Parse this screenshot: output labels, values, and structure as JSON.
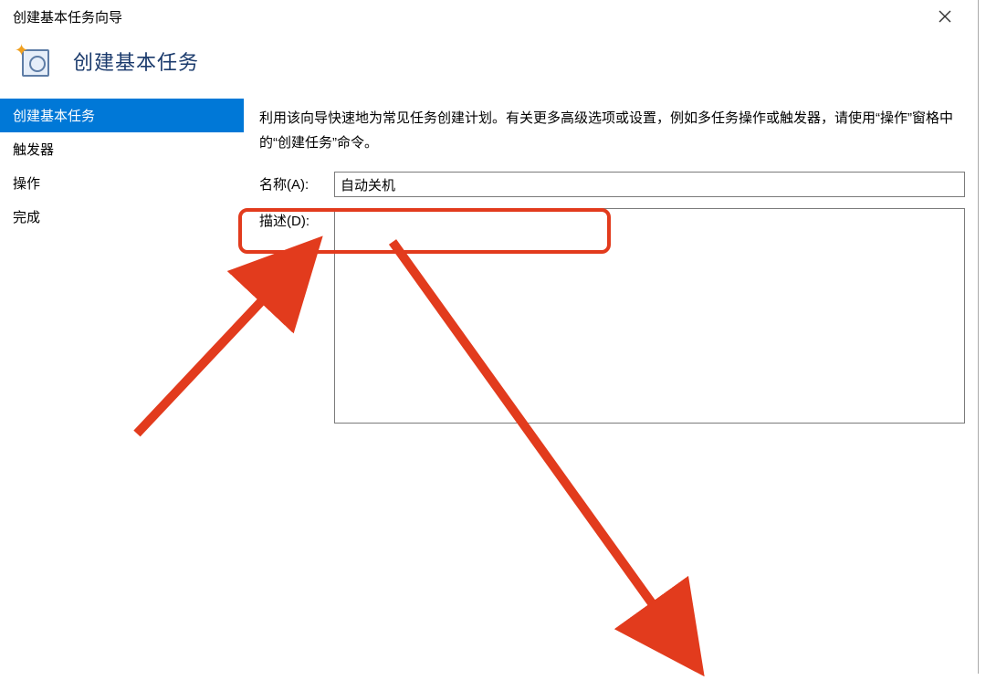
{
  "window": {
    "title": "创建基本任务向导"
  },
  "header": {
    "heading": "创建基本任务"
  },
  "sidebar": {
    "items": [
      {
        "label": "创建基本任务",
        "selected": true
      },
      {
        "label": "触发器",
        "selected": false
      },
      {
        "label": "操作",
        "selected": false
      },
      {
        "label": "完成",
        "selected": false
      }
    ]
  },
  "main": {
    "instruction": "利用该向导快速地为常见任务创建计划。有关更多高级选项或设置，例如多任务操作或触发器，请使用“操作”窗格中的“创建任务”命令。",
    "name_label": "名称(A):",
    "name_value": "自动关机",
    "desc_label": "描述(D):",
    "desc_value": ""
  }
}
